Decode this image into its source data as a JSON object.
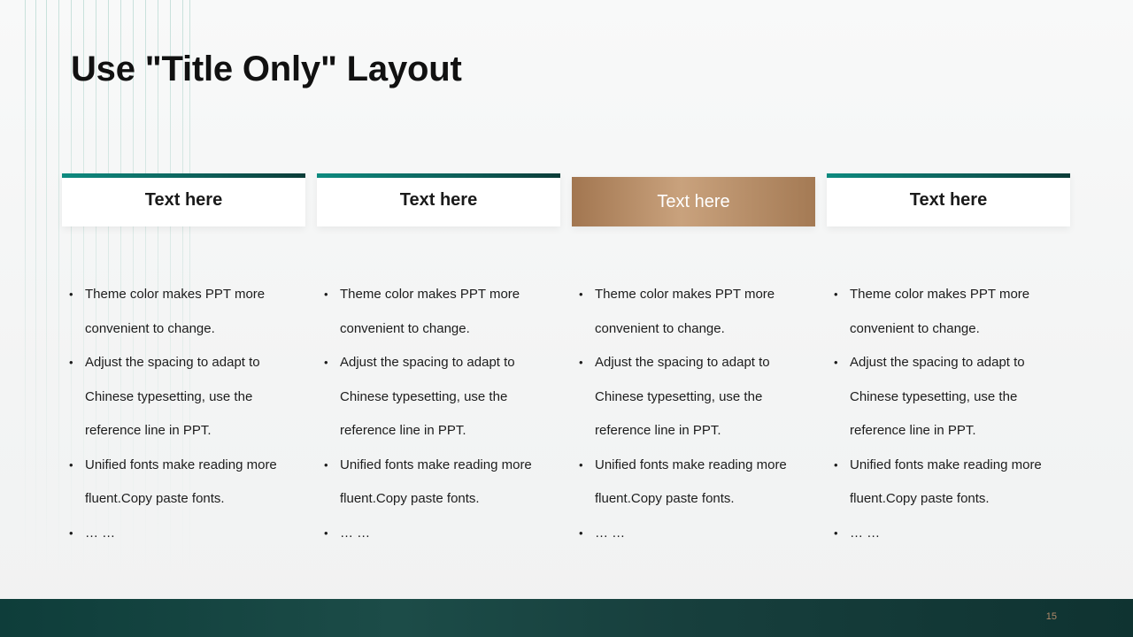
{
  "slide": {
    "title": "Use \"Title Only\" Layout",
    "page_number": "15"
  },
  "columns": [
    {
      "header": "Text here",
      "style": "teal",
      "bullets": [
        "Theme  color makes PPT more convenient to change.",
        "Adjust the spacing to adapt to Chinese typesetting, use the reference line in PPT.",
        "Unified fonts make reading more fluent.Copy paste fonts.",
        "… …"
      ]
    },
    {
      "header": "Text here",
      "style": "teal",
      "bullets": [
        "Theme  color makes PPT more convenient to change.",
        "Adjust the spacing to adapt to Chinese typesetting, use the reference line in PPT.",
        "Unified fonts make reading more fluent.Copy paste fonts.",
        "… …"
      ]
    },
    {
      "header": "Text here",
      "style": "bronze",
      "bullets": [
        "Theme  color makes PPT more convenient to change.",
        "Adjust the spacing to adapt to Chinese typesetting, use the reference line in PPT.",
        "Unified fonts make reading more fluent.Copy paste fonts.",
        "… …"
      ]
    },
    {
      "header": "Text here",
      "style": "teal",
      "bullets": [
        "Theme  color makes PPT more convenient to change.",
        "Adjust the spacing to adapt to Chinese typesetting, use the reference line in PPT.",
        "Unified fonts make reading more fluent.Copy paste fonts.",
        "… …"
      ]
    }
  ],
  "bullet_glyph": "•",
  "colors": {
    "teal_accent": "#0e7a72",
    "bronze_accent": "#b08a64",
    "footer": "#12403c",
    "page_number": "#b0896a"
  }
}
